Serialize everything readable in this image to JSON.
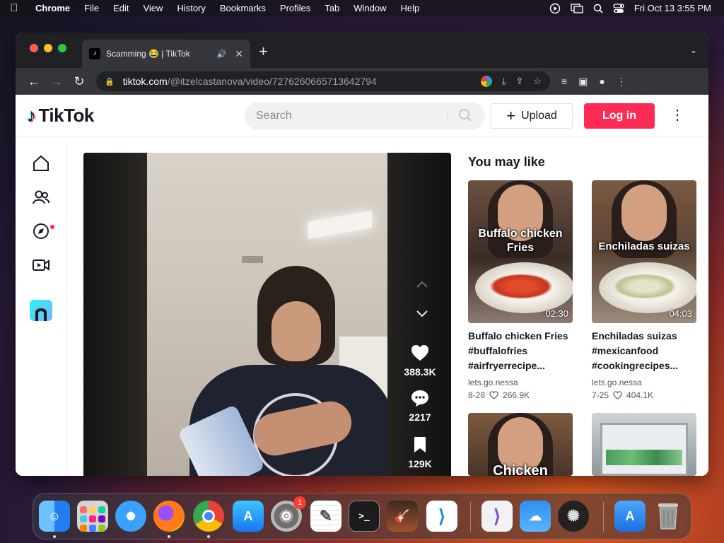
{
  "menubar": {
    "app": "Chrome",
    "items": [
      "File",
      "Edit",
      "View",
      "History",
      "Bookmarks",
      "Profiles",
      "Tab",
      "Window",
      "Help"
    ],
    "datetime": "Fri Oct 13  3:55 PM"
  },
  "browser": {
    "tab_title": "Scamming 😂 | TikTok",
    "url_host": "tiktok.com",
    "url_path": "/@itzelcastanova/video/7276260665713642794"
  },
  "tiktok": {
    "logo_text": "TikTok",
    "search_placeholder": "Search",
    "upload_label": "Upload",
    "login_label": "Log in"
  },
  "video": {
    "likes": "388.3K",
    "comments": "2217",
    "saves": "129K"
  },
  "sidebar": {
    "title": "You may like",
    "cards": [
      {
        "caption": "Buffalo chicken Fries",
        "duration": "02:30",
        "title": "Buffalo chicken Fries #buffalofries #airfryerrecipe...",
        "author": "lets.go.nessa",
        "date": "8-28",
        "likes": "266.9K"
      },
      {
        "caption": "Enchiladas suizas",
        "duration": "04:03",
        "title": "Enchiladas suizas #mexicanfood #cookingrecipes...",
        "author": "lets.go.nessa",
        "date": "7-25",
        "likes": "404.1K"
      },
      {
        "caption": "Chicken"
      }
    ]
  },
  "dock": {
    "badge_count": "1",
    "icons": [
      "finder-icon",
      "launchpad-icon",
      "safari-icon",
      "firefox-icon",
      "chrome-icon",
      "app-store-icon",
      "system-settings-icon",
      "textedit-icon",
      "terminal-icon",
      "garageband-icon",
      "vscode-icon",
      "visual-studio-icon",
      "weather-icon",
      "widget-icon",
      "app-store-downloads-icon",
      "trash-icon"
    ]
  }
}
